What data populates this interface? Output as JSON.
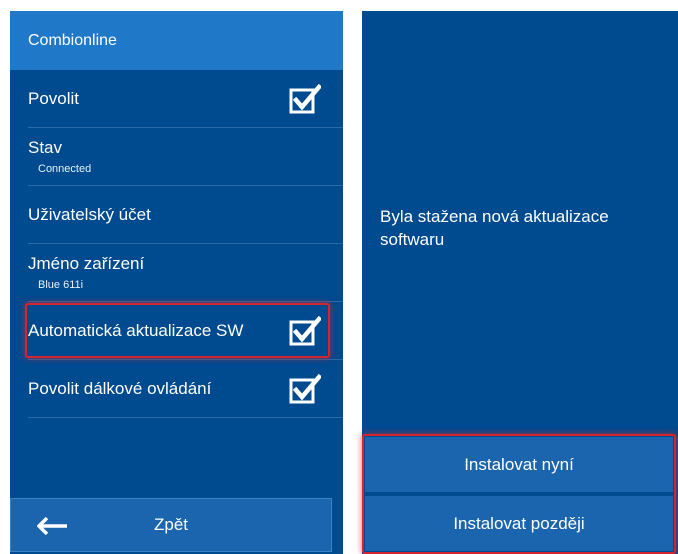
{
  "app": {
    "title": "Combionline"
  },
  "menu": {
    "items": [
      {
        "label": "Povolit",
        "checked": true
      },
      {
        "label": "Stav",
        "sub": "Connected"
      },
      {
        "label": "Uživatelský účet"
      },
      {
        "label": "Jméno zařízení",
        "sub": "Blue 611i"
      },
      {
        "label": "Automatická aktualizace SW",
        "checked": true,
        "highlighted": true
      },
      {
        "label": "Povolit dálkové ovládání",
        "checked": true
      }
    ]
  },
  "back_button": {
    "label": "Zpět",
    "icon": "arrow-left-icon"
  },
  "dialog": {
    "message": "Byla stažena nová aktualizace softwaru",
    "install_now_label": "Instalovat nyní",
    "install_later_label": "Instalovat později"
  },
  "colors": {
    "panel_bg": "#004a8f",
    "header_bg": "#1f78c8",
    "button_bg": "#1a65ad",
    "highlight": "#d5262f"
  }
}
